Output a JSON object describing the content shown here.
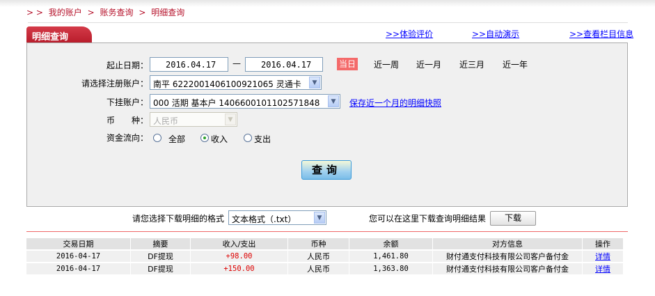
{
  "breadcrumb": {
    "prefix": "> >",
    "items": [
      "我的账户",
      "账务查询",
      "明细查询"
    ],
    "sep": ">"
  },
  "tab": {
    "title": "明细查询"
  },
  "top_links": [
    "体验评价",
    "自动演示",
    "查看栏目信息"
  ],
  "top_link_prefix": ">>",
  "form": {
    "date_label": "起止日期：",
    "date_start": "2016.04.17",
    "date_sep": "—",
    "date_end": "2016.04.17",
    "quick": [
      "当日",
      "近一周",
      "近一月",
      "近三月",
      "近一年"
    ],
    "quick_selected": "当日",
    "account_label": "请选择注册账户：",
    "account_value": "南平  6222001406100921065 灵通卡",
    "sub_label": "下挂账户：",
    "sub_value": "000 活期 基本户 1406600101102571848",
    "snapshot_link": "保存近一个月的明细快照",
    "currency_label": "币　　种：",
    "currency_value": "人民币",
    "flow_label": "资金流向：",
    "flow_options": [
      "全部",
      "收入",
      "支出"
    ],
    "flow_selected": "收入",
    "query_button": "查询"
  },
  "download": {
    "label": "请您选择下载明细的格式",
    "format": "文本格式（.txt）",
    "hint": "您可以在这里下载查询明细结果",
    "button": "下载"
  },
  "table": {
    "headers": [
      "交易日期",
      "摘要",
      "收入/支出",
      "币种",
      "余额",
      "对方信息",
      "操作"
    ],
    "rows": [
      [
        "2016-04-17",
        "DF提现",
        "+98.00",
        "人民币",
        "1,461.80",
        "财付通支付科技有限公司客户备付金",
        "详情"
      ],
      [
        "2016-04-17",
        "DF提现",
        "+150.00",
        "人民币",
        "1,363.80",
        "财付通支付科技有限公司客户备付金",
        "详情"
      ]
    ]
  },
  "colors": {
    "brand": "#b81c2b",
    "today": "#f46a6a",
    "link": "#0000ff",
    "amount": "#dd0000"
  }
}
